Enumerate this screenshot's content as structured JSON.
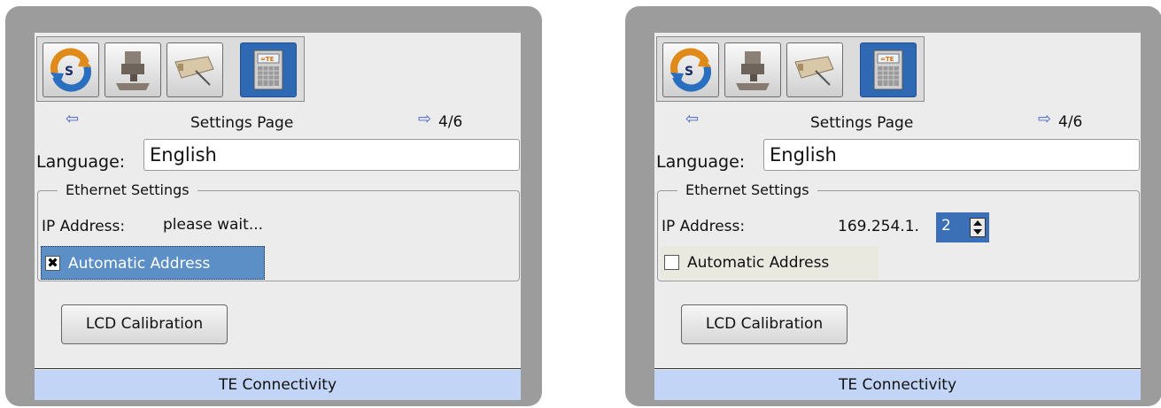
{
  "screens": [
    {
      "toolbar": {
        "buttons": [
          "refresh-icon",
          "machine-icon",
          "applicator-icon",
          "te-device-icon"
        ],
        "active_index": 3
      },
      "nav": {
        "prev_icon": "arrow-left-icon",
        "title": "Settings Page",
        "next_icon": "arrow-right-icon",
        "page": "4/6"
      },
      "language": {
        "label": "Language:",
        "value": "English"
      },
      "ethernet": {
        "legend": "Ethernet Settings",
        "ip_label": "IP Address:",
        "ip_status": "please wait...",
        "auto_label": "Automatic Address",
        "auto_checked": true
      },
      "lcd_button": "LCD Calibration",
      "footer": "TE Connectivity"
    },
    {
      "toolbar": {
        "buttons": [
          "refresh-icon",
          "machine-icon",
          "applicator-icon",
          "te-device-icon"
        ],
        "active_index": 3
      },
      "nav": {
        "prev_icon": "arrow-left-icon",
        "title": "Settings Page",
        "next_icon": "arrow-right-icon",
        "page": "4/6"
      },
      "language": {
        "label": "Language:",
        "value": "English"
      },
      "ethernet": {
        "legend": "Ethernet Settings",
        "ip_label": "IP Address:",
        "ip_prefix": "169.254.1.",
        "ip_last_octet": "2",
        "auto_label": "Automatic Address",
        "auto_checked": false
      },
      "lcd_button": "LCD Calibration",
      "footer": "TE Connectivity"
    }
  ],
  "colors": {
    "panel": "#9c9c9c",
    "screen": "#ececec",
    "accent": "#2f69b4",
    "footer": "#c3d5f7",
    "arrow": "#4a68c8"
  }
}
